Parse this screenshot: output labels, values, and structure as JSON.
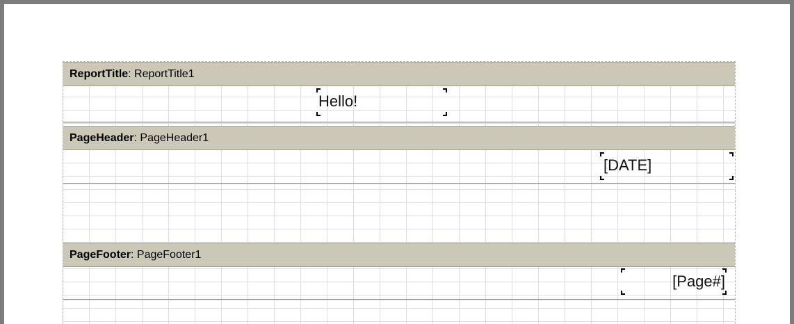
{
  "sections": [
    {
      "type": "ReportTitle",
      "name": "ReportTitle1",
      "field": "Hello!"
    },
    {
      "type": "PageHeader",
      "name": "PageHeader1",
      "field": "[DATE]"
    },
    {
      "type": "PageFooter",
      "name": "PageFooter1",
      "field": "[Page#]"
    }
  ],
  "separator": ": ",
  "colors": {
    "band_header_bg": "#cbc8b8",
    "frame": "#7c7c7c",
    "grid": "#dedede"
  }
}
